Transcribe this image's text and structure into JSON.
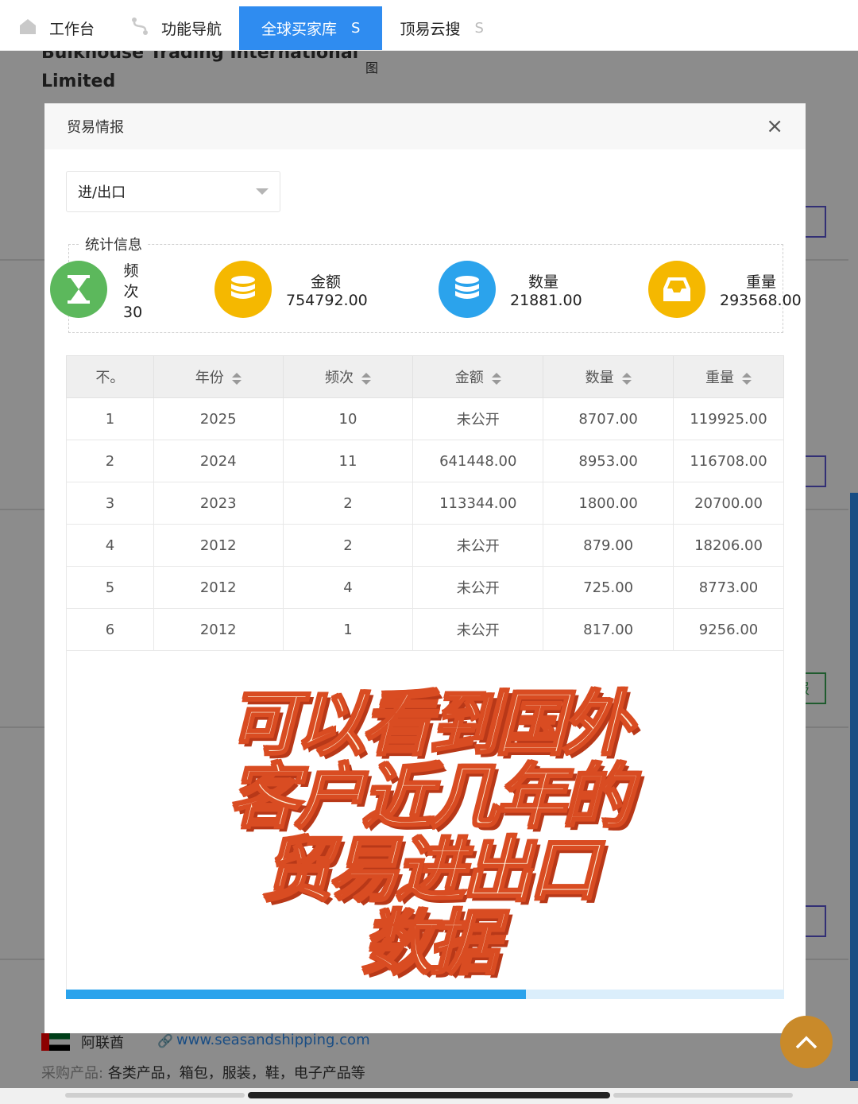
{
  "tabs": [
    {
      "label": "工作台",
      "icon": "home-icon",
      "active": false
    },
    {
      "label": "功能导航",
      "icon": "route-icon",
      "active": false
    },
    {
      "label": "全球买家库",
      "close": "S",
      "active": true
    },
    {
      "label": "顶易云搜",
      "close": "S",
      "active": false
    }
  ],
  "background": {
    "company_line1": "Bulkhouse Trading International",
    "company_line2": "Limited",
    "image_label": "图",
    "country": "阿联酋",
    "website": "www.seasandshipping.com",
    "products_label": "采购产品:",
    "products_value": "各类产品，箱包，服装，鞋，电子产品等",
    "side_button_text": "报"
  },
  "modal": {
    "title": "贸易情报",
    "close": "×",
    "select_value": "进/出口",
    "stats_legend": "统计信息",
    "stats": [
      {
        "label": "频次",
        "value": "30",
        "icon": "hourglass-icon",
        "color": "#5cb85c"
      },
      {
        "label": "金额",
        "value": "754792.00",
        "icon": "database-icon",
        "color": "#f5b800"
      },
      {
        "label": "数量",
        "value": "21881.00",
        "icon": "database-icon",
        "color": "#2ba3ec"
      },
      {
        "label": "重量",
        "value": "293568.00",
        "icon": "inbox-icon",
        "color": "#f5b800"
      }
    ],
    "table": {
      "headers": [
        "不。",
        "年份",
        "频次",
        "金额",
        "数量",
        "重量"
      ],
      "rows": [
        [
          "1",
          "2025",
          "10",
          "未公开",
          "8707.00",
          "119925.00"
        ],
        [
          "2",
          "2024",
          "11",
          "641448.00",
          "8953.00",
          "116708.00"
        ],
        [
          "3",
          "2023",
          "2",
          "113344.00",
          "1800.00",
          "20700.00"
        ],
        [
          "4",
          "2012",
          "2",
          "未公开",
          "879.00",
          "18206.00"
        ],
        [
          "5",
          "2012",
          "4",
          "未公开",
          "725.00",
          "8773.00"
        ],
        [
          "6",
          "2012",
          "1",
          "未公开",
          "817.00",
          "9256.00"
        ]
      ]
    },
    "scroll_progress": 0.64
  },
  "caption": {
    "line1": "可以看到国外",
    "line2": "客户近几年的",
    "line3": "贸易进出口",
    "line4": "数据"
  }
}
